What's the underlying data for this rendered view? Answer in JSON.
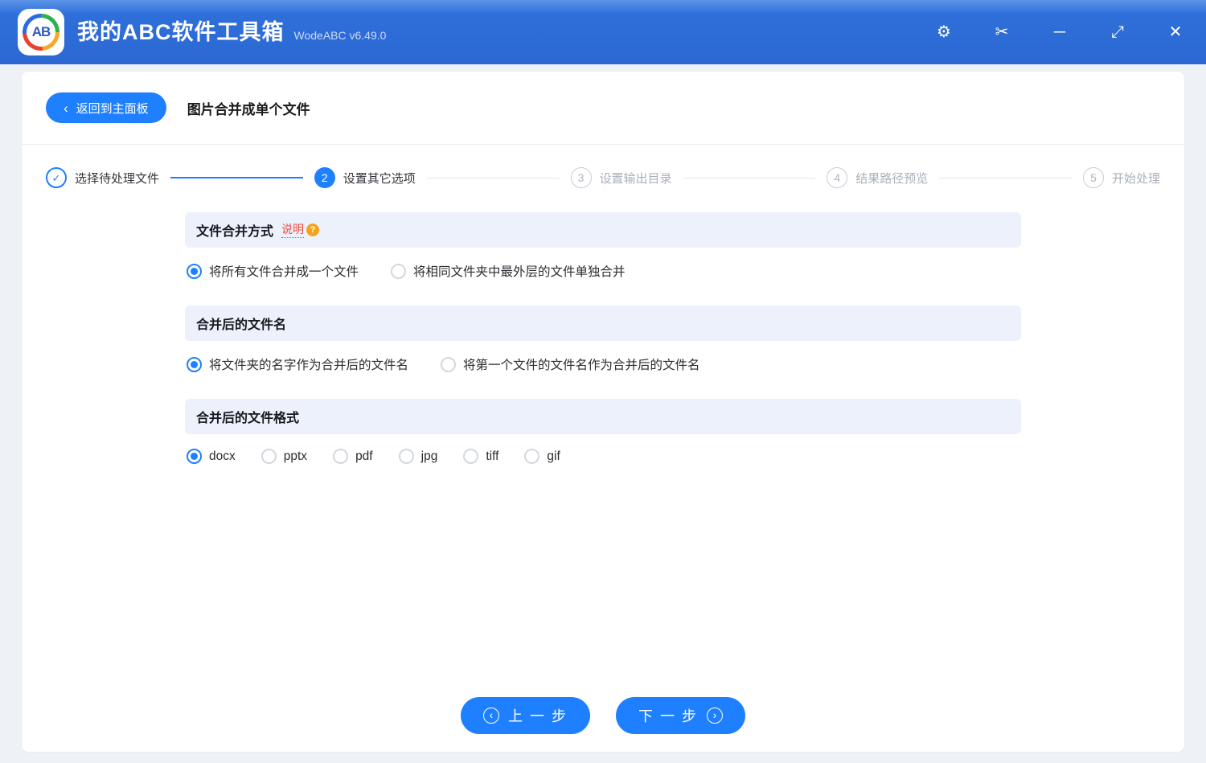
{
  "titlebar": {
    "logo_text": "AB",
    "app_title": "我的ABC软件工具箱",
    "app_version": "WodeABC v6.49.0"
  },
  "toolbar": {
    "back_label": "返回到主面板",
    "page_title": "图片合并成单个文件"
  },
  "steps": [
    {
      "num": "✓",
      "label": "选择待处理文件",
      "state": "done"
    },
    {
      "num": "2",
      "label": "设置其它选项",
      "state": "active"
    },
    {
      "num": "3",
      "label": "设置输出目录",
      "state": "pending"
    },
    {
      "num": "4",
      "label": "结果路径预览",
      "state": "pending"
    },
    {
      "num": "5",
      "label": "开始处理",
      "state": "pending"
    }
  ],
  "sections": [
    {
      "title": "文件合并方式",
      "help_label": "说明",
      "options": [
        {
          "label": "将所有文件合并成一个文件",
          "selected": true
        },
        {
          "label": "将相同文件夹中最外层的文件单独合并",
          "selected": false
        }
      ]
    },
    {
      "title": "合并后的文件名",
      "options": [
        {
          "label": "将文件夹的名字作为合并后的文件名",
          "selected": true
        },
        {
          "label": "将第一个文件的文件名作为合并后的文件名",
          "selected": false
        }
      ]
    },
    {
      "title": "合并后的文件格式",
      "options": [
        {
          "label": "docx",
          "selected": true
        },
        {
          "label": "pptx",
          "selected": false
        },
        {
          "label": "pdf",
          "selected": false
        },
        {
          "label": "jpg",
          "selected": false
        },
        {
          "label": "tiff",
          "selected": false
        },
        {
          "label": "gif",
          "selected": false
        }
      ]
    }
  ],
  "footer": {
    "prev_label": "上 一 步",
    "next_label": "下 一 步"
  },
  "icons": {
    "check": "✓",
    "gear": "⚙",
    "scissors": "✂",
    "minimize": "─",
    "maximize": "⤢",
    "close": "✕",
    "back_chevron": "‹",
    "arrow_left": "‹",
    "arrow_right": "›",
    "help": "?"
  },
  "colors": {
    "accent": "#1e80ff",
    "titlebar_blue": "#2f6fd9",
    "section_header_bg": "#edf1fb",
    "help_red": "#f5493d",
    "help_orange": "#f7a21b"
  }
}
